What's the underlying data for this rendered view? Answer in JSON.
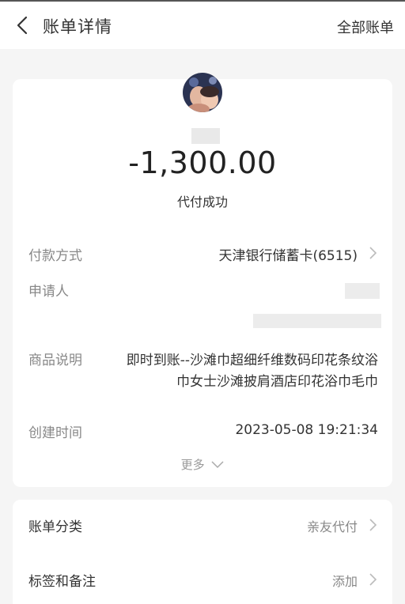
{
  "nav": {
    "title": "账单详情",
    "right_label": "全部账单"
  },
  "summary": {
    "amount": "-1,300.00",
    "status": "代付成功"
  },
  "details": {
    "payment_method": {
      "label": "付款方式",
      "value": "天津银行储蓄卡(6515)"
    },
    "applicant": {
      "label": "申请人"
    },
    "product": {
      "label": "商品说明",
      "line1": "即时到账--沙滩巾超细纤维数码印花条纹浴",
      "line2": "巾女士沙滩披肩酒店印花浴巾毛巾"
    },
    "created": {
      "label": "创建时间",
      "value": "2023-05-08 19:21:34"
    },
    "more_label": "更多"
  },
  "extra": {
    "category": {
      "label": "账单分类",
      "value": "亲友代付"
    },
    "tags": {
      "label": "标签和备注",
      "value": "添加"
    }
  },
  "colors": {
    "background": "#f5f5f5",
    "card": "#ffffff",
    "muted": "#888888"
  }
}
